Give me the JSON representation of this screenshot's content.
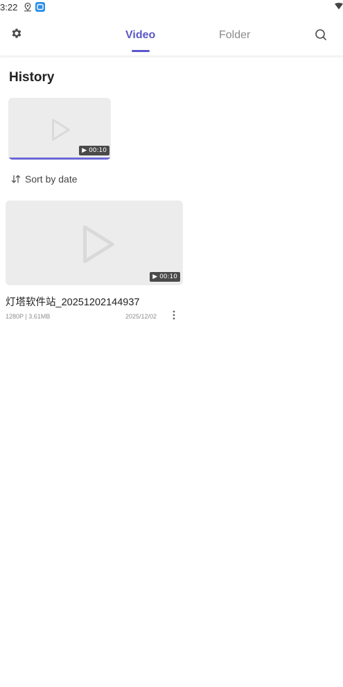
{
  "status_bar": {
    "time": "3:22"
  },
  "app_bar": {
    "tabs": [
      {
        "label": "Video",
        "active": true
      },
      {
        "label": "Folder",
        "active": false
      }
    ],
    "accent_color": "#5b57c9"
  },
  "history": {
    "title": "History",
    "items": [
      {
        "duration": "▶ 00:10",
        "progress": 0.99
      }
    ]
  },
  "sort": {
    "label": "Sort by date"
  },
  "videos": [
    {
      "title": "灯塔软件站_20251202144937",
      "meta": "1280P | 3.61MB",
      "date": "2025/12/02",
      "duration": "▶ 00:10"
    }
  ],
  "icons": {
    "settings": "gear-icon",
    "search": "search-icon",
    "play": "play-icon",
    "sort": "sort-icon",
    "more": "more-vert-icon"
  }
}
